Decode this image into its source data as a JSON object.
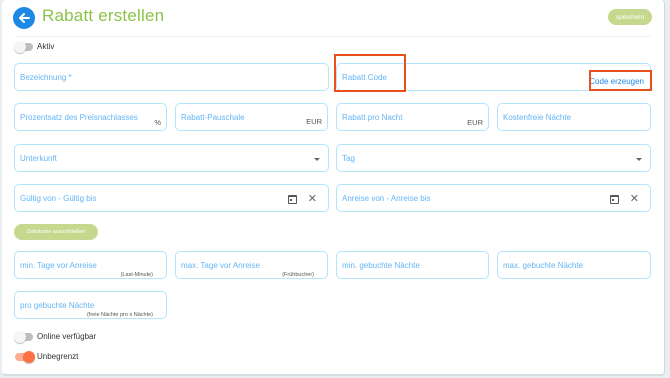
{
  "header": {
    "title": "Rabatt erstellen",
    "save_label": "speichern"
  },
  "toggles": {
    "aktiv": {
      "label": "Aktiv",
      "on": false
    },
    "online": {
      "label": "Online verfügbar",
      "on": false
    },
    "unbegrenzt": {
      "label": "Unbegrenzt",
      "on": true
    }
  },
  "fields": {
    "bezeichnung": "Bezeichnung *",
    "rabatt_code": "Rabatt Code",
    "code_erzeugen": "Code erzeugen",
    "prozentsatz": "Prozentsatz des Preisnachlasses",
    "prozent_suffix": "%",
    "pauschale": "Rabatt-Pauschale",
    "pauschale_suffix": "EUR",
    "pro_nacht": "Rabatt pro Nacht",
    "pro_nacht_suffix": "EUR",
    "kostenfrei": "Kostenfreie Nächte",
    "unterkunft": "Unterkunft",
    "tag": "Tag",
    "gueltig": "Gültig von - Gültig bis",
    "anreise": "Anreise von - Anreise bis",
    "min_tage": "min. Tage vor Anreise",
    "min_tage_hint": "(Last-Minute)",
    "max_tage": "max. Tage vor Anreise",
    "max_tage_hint": "(Frühbucher)",
    "min_naechte": "min. gebuchte Nächte",
    "max_naechte": "max. gebuchte Nächte",
    "pro_naechte": "pro gebuchte Nächte",
    "pro_naechte_hint": "(freie Nächte pro x Nächte)"
  },
  "zeitraeume_label": "Zeiträume ausschließen",
  "colors": {
    "accent_green": "#8bc34a",
    "primary_blue": "#1e88e5",
    "highlight": "#e8501c",
    "toggle_on": "#ff7043"
  }
}
